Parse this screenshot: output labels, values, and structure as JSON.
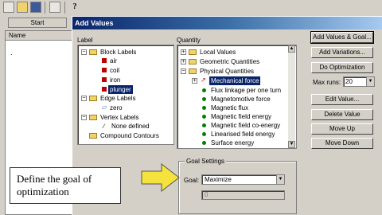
{
  "window": {
    "start_button": "Start",
    "name_header": "Name",
    "list_item": "."
  },
  "dialog": {
    "title": "Add Values",
    "label_header": "Label",
    "quantity_header": "Quantity",
    "label_tree": [
      "Block Labels",
      "air",
      "coil",
      "iron",
      "plunger",
      "Edge Labels",
      "zero",
      "Vertex Labels",
      "None defined",
      "Compound Contours"
    ],
    "quantity_tree": [
      "Local Values",
      "Geometric Quantities",
      "Physical Quantities",
      "Mechanical force",
      "Flux linkage per one turn",
      "Magnetomotive force",
      "Magnetic flux",
      "Magnetic field energy",
      "Magnetic field co-energy",
      "Linearised field energy",
      "Surface energy"
    ],
    "buttons": {
      "add_values_goal": "Add Values & Goal...",
      "add_variations": "Add Variations...",
      "do_optimization": "Do Optimization",
      "max_runs_label": "Max runs:",
      "max_runs_value": "20",
      "edit_value": "Edit Value...",
      "delete_value": "Delete Value",
      "move_up": "Move Up",
      "move_down": "Move Down"
    },
    "goal_settings": {
      "title": "Goal Settings",
      "goal_label": "Goal:",
      "goal_value": "Maximize",
      "value_field": "0"
    }
  },
  "callout": {
    "text": "Define the goal of optimization"
  },
  "colors": {
    "title_bar": "#0a246a",
    "selection": "#0a246a",
    "block_icon": "#c00000",
    "quantity_dot": "#008000",
    "arrow": "#f5e23c"
  }
}
